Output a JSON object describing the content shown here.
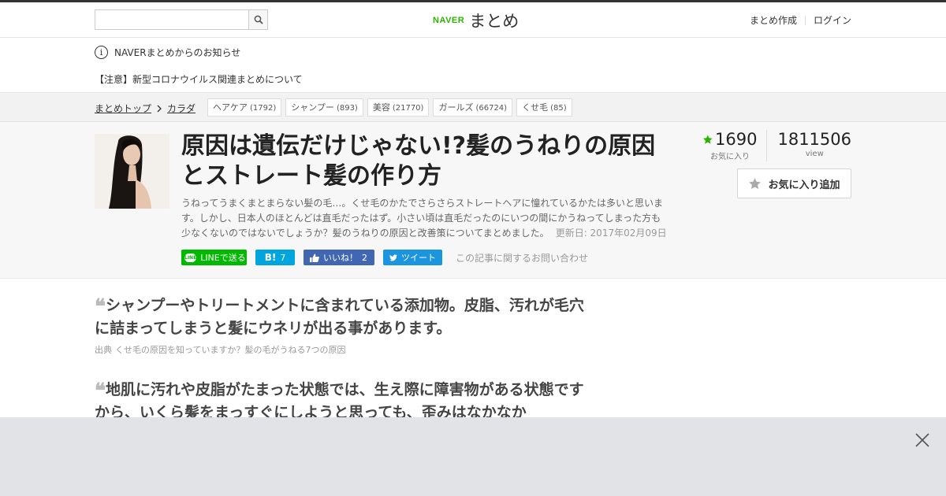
{
  "header": {
    "search_placeholder": "",
    "logo_brand": "NAVER",
    "logo_text": "まとめ",
    "links": [
      "まとめ作成",
      "ログイン"
    ]
  },
  "notice": {
    "title": "NAVERまとめからのお知らせ",
    "item": "【注意】新型コロナウイルス関連まとめについて"
  },
  "breadcrumb": {
    "items": [
      "まとめトップ",
      "カラダ"
    ],
    "tags": [
      {
        "label": "ヘアケア",
        "count": "(1792)"
      },
      {
        "label": "シャンプー",
        "count": "(893)"
      },
      {
        "label": "美容",
        "count": "(21770)"
      },
      {
        "label": "ガールズ",
        "count": "(66724)"
      },
      {
        "label": "くせ毛",
        "count": "(85)"
      }
    ]
  },
  "article": {
    "title": "原因は遺伝だけじゃない!?髪のうねりの原因とストレート髪の作り方",
    "description": "うねってうまくまとまらない髪の毛…。くせ毛のかたでさらさらストレートヘアに憧れているかたは多いと思います。しかし、日本人のほとんどは直毛だったはず。小さい頃は直毛だったのにいつの間にかうねってしまった方も少なくないのではないでしょうか？髪のうねりの原因と改善策についてまとめました。",
    "updated": "更新日: 2017年02月09日",
    "favorites": "1690",
    "favorites_label": "お気に入り",
    "views": "1811506",
    "views_label": "view",
    "fav_button": "お気に入り追加"
  },
  "social": {
    "line": "LINEで送る",
    "line_badge": "LINE",
    "hatena_icon": "B!",
    "hatena_count": "7",
    "fb": "いいね！",
    "fb_count": "2",
    "tweet": "ツイート",
    "contact": "この記事に関するお問い合わせ"
  },
  "quotes": [
    {
      "mark": "❝",
      "text": "シャンプーやトリートメントに含まれている添加物。皮脂、汚れが毛穴に詰まってしまうと髪にウネリが出る事があります。",
      "source_label": "出典",
      "source_link": "くせ毛の原因を知っていますか？髪の毛がうねる7つの原因"
    },
    {
      "mark": "❝",
      "text": "地肌に汚れや皮脂がたまった状態では、生え際に障害物がある状態ですから、いくら髪をまっすぐにしようと思っても、歪みはなかなか"
    }
  ],
  "colors": {
    "naver_green": "#2db400",
    "line_green": "#00b900",
    "hatena_blue": "#00a4de",
    "facebook_blue": "#4267b2",
    "twitter_blue": "#1b95e0",
    "overlay_gray": "#e1e3e6"
  },
  "icons": [
    "search-icon",
    "info-icon",
    "chevron-right-icon",
    "star-icon",
    "thumbs-up-icon",
    "twitter-bird-icon",
    "close-icon"
  ]
}
